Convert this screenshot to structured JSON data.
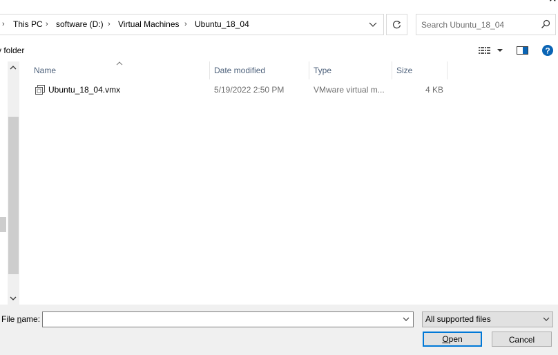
{
  "window": {
    "close_glyph": "✕"
  },
  "address_bar": {
    "breadcrumbs": [
      {
        "label": "This PC"
      },
      {
        "label": "software (D:)"
      },
      {
        "label": "Virtual Machines"
      },
      {
        "label": "Ubuntu_18_04"
      }
    ],
    "separator_icon": "chevron-right-icon",
    "dropdown_icon": "chevron-down-icon",
    "refresh_icon": "refresh-icon"
  },
  "search": {
    "placeholder": "Search Ubuntu_18_04",
    "value": "",
    "icon": "search-icon"
  },
  "toolbar": {
    "new_folder_label": "v folder",
    "view_icon": "details-view-icon",
    "preview_icon": "preview-pane-icon",
    "help_icon": "help-icon",
    "help_glyph": "?"
  },
  "file_list": {
    "columns": [
      "Name",
      "Date modified",
      "Type",
      "Size"
    ],
    "sort_indicator": "^",
    "rows": [
      {
        "name": "Ubuntu_18_04.vmx",
        "date_modified": "5/19/2022 2:50 PM",
        "type": "VMware virtual m...",
        "size": "4 KB",
        "icon": "vmx-file-icon"
      }
    ]
  },
  "footer": {
    "file_name_label_pre": "File ",
    "file_name_label_u": "n",
    "file_name_label_post": "ame:",
    "file_name_value": "",
    "file_type_selected": "All supported files",
    "open_u": "O",
    "open_rest": "pen",
    "cancel_label": "Cancel"
  },
  "colors": {
    "accent": "#0078d7",
    "help_blue": "#0a64b4",
    "header_text": "#4c607a"
  }
}
